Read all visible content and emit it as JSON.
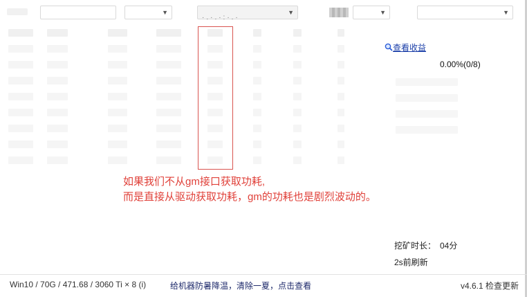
{
  "annotation": {
    "line1": "如果我们不从gm接口获取功耗,",
    "line2": "而是直接从驱动获取功耗，gm的功耗也是剧烈波动的。"
  },
  "right_panel": {
    "earnings_link": "查看收益",
    "percent": "0.00%(0/8)",
    "mining_label": "挖矿时长：",
    "mining_value": "04分",
    "refresh": "2s前刷新"
  },
  "footer": {
    "system_info": "Win10  / 70G / 471.68 / 3060 Ti × 8 (i)",
    "tip_links": [
      "给机器防暑降温",
      "清除一夏",
      "点击查看"
    ],
    "version": "v4.6.1",
    "check_update": "检查更新"
  },
  "colors": {
    "annotation_red": "#e0413a",
    "highlight_border": "#d9534f",
    "link_blue": "#1a3ea8"
  }
}
